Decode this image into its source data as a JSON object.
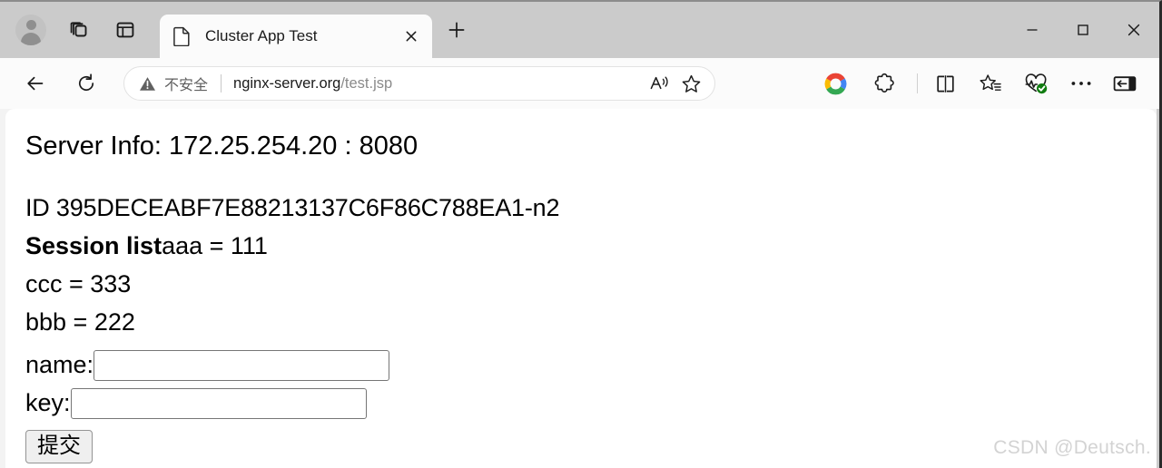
{
  "browser": {
    "tab_strip": {
      "avatar": "profile-avatar",
      "workspaces_icon": "workspaces-icon",
      "split_panel_icon": "tab-actions-panel-icon",
      "tab": {
        "title": "Cluster App Test",
        "favicon": "page-document-icon",
        "close_label": "✕"
      },
      "new_tab_label": "+"
    },
    "window_controls": {
      "minimize": "—",
      "maximize": "□",
      "close": "✕"
    },
    "toolbar": {
      "back_icon": "back-arrow-icon",
      "reload_icon": "reload-icon",
      "security_label": "不安全",
      "security_icon": "warning-triangle-icon",
      "url_host": "nginx-server.org",
      "url_path": "/test.jsp",
      "read_aloud_icon": "read-aloud-icon",
      "favorite_icon": "star-outline-icon",
      "copilot_icon": "copilot-icon",
      "extensions_icon": "extensions-puzzle-icon",
      "split_screen_icon": "split-screen-icon",
      "collections_icon": "collections-star-icon",
      "essentials_icon": "browser-essentials-heart-icon",
      "more_icon": "ellipsis-icon",
      "sidebar_icon": "sidebar-toggle-icon"
    }
  },
  "page": {
    "server_info": "Server Info: 172.25.254.20 : 8080",
    "session_id": "ID 395DECEABF7E88213137C6F86C788EA1-n2",
    "session_list_label": "Session list",
    "session_entries": [
      "aaa = 111",
      "ccc = 333",
      "bbb = 222"
    ],
    "form": {
      "name_label": "name:",
      "name_value": "",
      "key_label": "key:",
      "key_value": "",
      "submit_label": "提交"
    },
    "watermark": "CSDN @Deutsch."
  }
}
